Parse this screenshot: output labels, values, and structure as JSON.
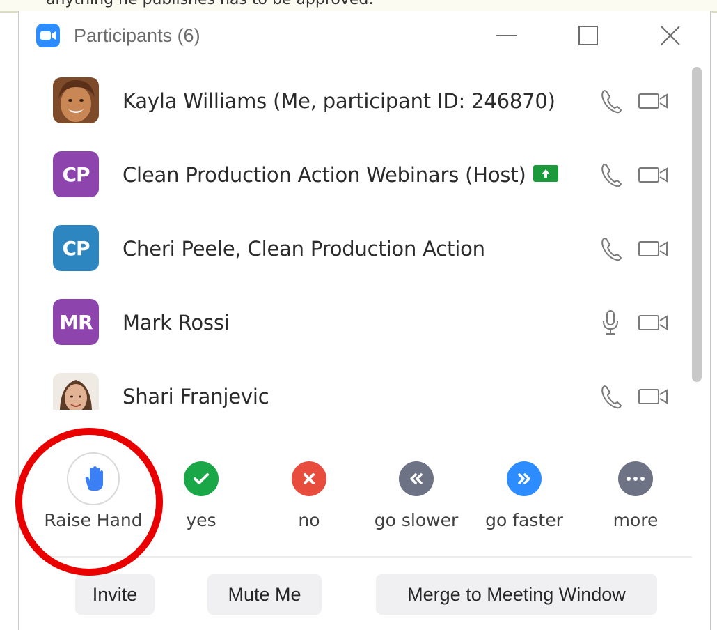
{
  "background_text": "anything he publishes has to be approved.",
  "window": {
    "title": "Participants (6)",
    "controls": {
      "minimize_icon": "minimize-icon",
      "maximize_icon": "maximize-icon",
      "close_icon": "close-icon"
    }
  },
  "participants": [
    {
      "name": "Kayla Williams (Me, participant ID: 246870)",
      "avatar_type": "photo",
      "audio_icon": "phone-icon",
      "video_icon": "video-off-icon"
    },
    {
      "name": "Clean Production Action Webinars (Host)",
      "avatar_initials": "CP",
      "avatar_color": "#8e44ad",
      "badge_icon": "screen-share-icon",
      "badge_color": "#1a9a3a",
      "audio_icon": "phone-icon",
      "video_icon": "video-off-icon"
    },
    {
      "name": "Cheri Peele, Clean Production Action",
      "avatar_initials": "CP",
      "avatar_color": "#2e86c1",
      "audio_icon": "phone-icon",
      "video_icon": "video-off-icon"
    },
    {
      "name": "Mark Rossi",
      "avatar_initials": "MR",
      "avatar_color": "#8e44ad",
      "audio_icon": "microphone-icon",
      "video_icon": "video-off-icon"
    },
    {
      "name": "Shari Franjevic",
      "avatar_type": "photo",
      "audio_icon": "phone-icon",
      "video_icon": "video-off-icon"
    }
  ],
  "reactions": [
    {
      "label": "Raise Hand",
      "icon": "raise-hand-icon",
      "color": "#3b7ff5"
    },
    {
      "label": "yes",
      "icon": "check-icon",
      "color": "#1aa748"
    },
    {
      "label": "no",
      "icon": "x-icon",
      "color": "#e74c3c"
    },
    {
      "label": "go slower",
      "icon": "rewind-icon",
      "color": "#6e7285"
    },
    {
      "label": "go faster",
      "icon": "fast-forward-icon",
      "color": "#2d8cff"
    },
    {
      "label": "more",
      "icon": "more-icon",
      "color": "#6e7285"
    }
  ],
  "buttons": {
    "invite": "Invite",
    "mute_me": "Mute Me",
    "merge": "Merge to Meeting Window"
  },
  "annotation": {
    "color": "#e90000",
    "target": "Raise Hand"
  }
}
